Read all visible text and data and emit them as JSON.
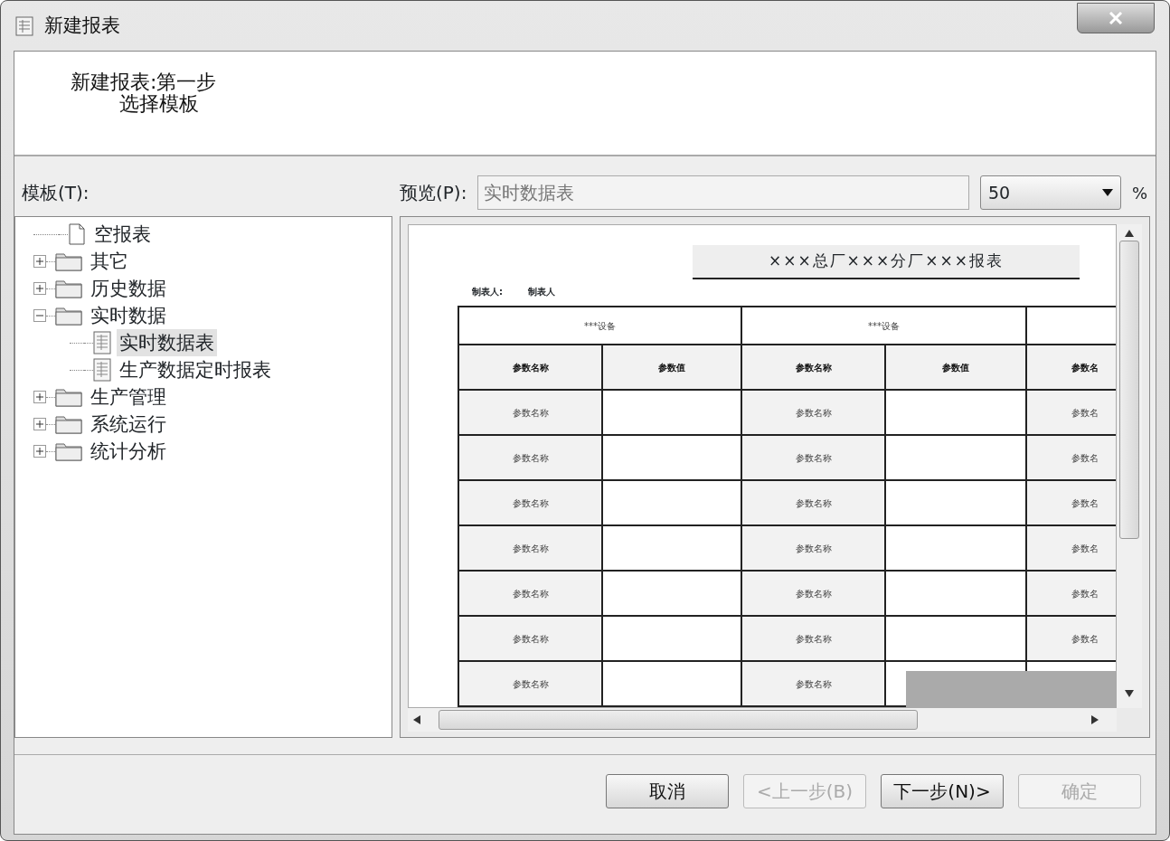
{
  "window": {
    "title": "新建报表"
  },
  "header": {
    "title": "新建报表:第一步",
    "subtitle": "选择模板"
  },
  "template_label": "模板(T):",
  "tree": [
    {
      "label": "空报表",
      "kind": "file",
      "selected": false
    },
    {
      "label": "其它",
      "kind": "folder",
      "expanded": false,
      "selected": false
    },
    {
      "label": "历史数据",
      "kind": "folder",
      "expanded": false,
      "selected": false
    },
    {
      "label": "实时数据",
      "kind": "folder",
      "expanded": true,
      "selected": false,
      "children": [
        {
          "label": "实时数据表",
          "kind": "report",
          "selected": true
        },
        {
          "label": "生产数据定时报表",
          "kind": "report",
          "selected": false
        }
      ]
    },
    {
      "label": "生产管理",
      "kind": "folder",
      "expanded": false,
      "selected": false
    },
    {
      "label": "系统运行",
      "kind": "folder",
      "expanded": false,
      "selected": false
    },
    {
      "label": "统计分析",
      "kind": "folder",
      "expanded": false,
      "selected": false
    }
  ],
  "preview": {
    "label": "预览(P):",
    "name_value": "实时数据表",
    "zoom": "50",
    "percent": "%",
    "document": {
      "title": "×××总厂×××分厂×××报表",
      "preparer_label": "制表人:",
      "preparer": "制表人",
      "group_headers": [
        "***设备",
        "***设备"
      ],
      "column_headers": [
        "参数名称",
        "参数值",
        "参数名称",
        "参数值",
        "参数名"
      ],
      "rows": [
        {
          "cells": [
            "参数名称",
            "参数名称",
            "参数名"
          ]
        },
        {
          "cells": [
            "参数名称",
            "参数名称",
            "参数名"
          ]
        },
        {
          "cells": [
            "参数名称",
            "参数名称",
            "参数名"
          ]
        },
        {
          "cells": [
            "参数名称",
            "参数名称",
            "参数名"
          ]
        },
        {
          "cells": [
            "参数名称",
            "参数名称",
            "参数名"
          ]
        },
        {
          "cells": [
            "参数名称",
            "参数名称",
            "参数名"
          ]
        },
        {
          "cells": [
            "参数名称",
            "参数名称"
          ]
        }
      ]
    }
  },
  "buttons": [
    {
      "label": "取消",
      "disabled": false
    },
    {
      "label": "<上一步(B)",
      "disabled": true
    },
    {
      "label": "下一步(N)>",
      "disabled": false
    },
    {
      "label": "确定",
      "disabled": true
    }
  ]
}
